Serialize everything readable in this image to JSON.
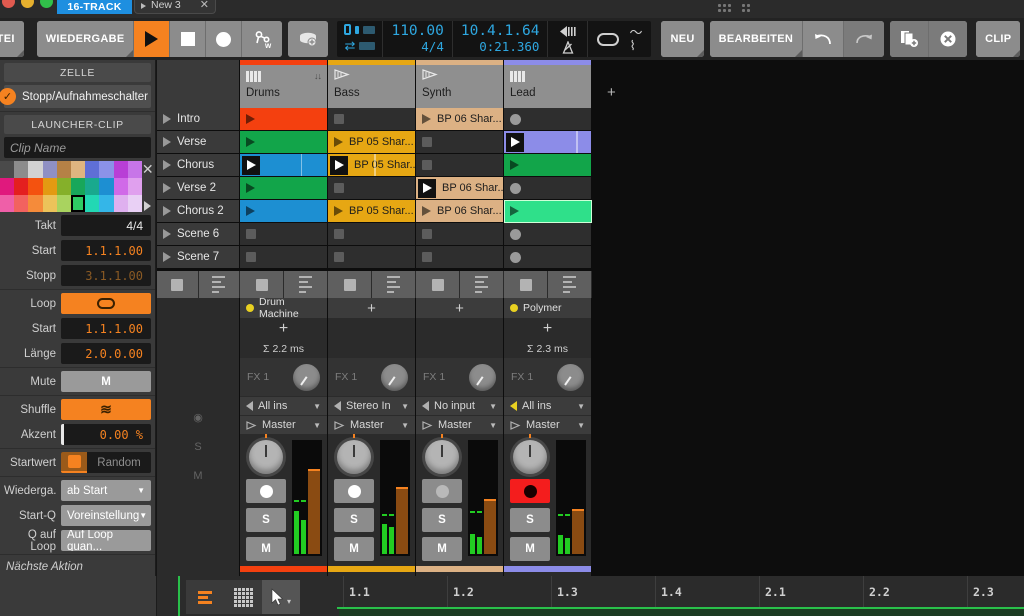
{
  "window": {
    "tab_16track": "16-TRACK",
    "tab_new": "New 3",
    "close_glyph": "✕"
  },
  "toolbar": {
    "file_label": "DATEI",
    "playback_label": "WIEDERGABE",
    "play_icon": "play-icon",
    "stop_icon": "stop-icon",
    "record_icon": "record-icon",
    "automation_icon": "automation-write-icon",
    "tap_icon": "tap-tempo-icon",
    "tempo": "110.00",
    "signature": "4/4",
    "position": "10.4.1.64",
    "time": "0:21.360",
    "preroll_icon": "pre-roll-icon",
    "metronome_icon": "metronome-icon",
    "loop_icon": "loop-icon",
    "curve_icons": [
      "fade-curve-icon",
      "groove-curve-icon"
    ],
    "new_label": "NEU",
    "edit_label": "BEARBEITEN",
    "undo_icon": "undo-icon",
    "redo_icon": "redo-icon",
    "duplicate_icon": "duplicate-icon",
    "delete_icon": "delete-icon",
    "clip_label": "CLIP"
  },
  "inspector": {
    "cell_header": "ZELLE",
    "stop_rec_toggle": "Stopp/Aufnahmeschalter",
    "stop_rec_checked": true,
    "launcher_header": "LAUNCHER-CLIP",
    "clip_name_placeholder": "Clip Name",
    "palette": {
      "close_glyph": "✕",
      "rows": [
        [
          "#4a4a4a",
          "#8c8c8c",
          "#d2d2d2",
          "#8f90c4",
          "#b58146",
          "#dfb580",
          "#5f6fd6",
          "#8b92e8",
          "#b83fd6",
          "#c775e8"
        ],
        [
          "#e0197d",
          "#e41f1f",
          "#f4520f",
          "#e39a12",
          "#85b02a",
          "#18a75a",
          "#19a98e",
          "#1d8fd2",
          "#d06ae8",
          "#e0a0ee"
        ],
        [
          "#ef5fa8",
          "#f2625f",
          "#f58b3a",
          "#ecc35a",
          "#a9d35f",
          "#2fcc63",
          "#22d8b4",
          "#34b6e8",
          "#dfb0ef",
          "#e9d0f5"
        ]
      ],
      "selected_row": 2,
      "selected_col": 5
    },
    "fields": [
      {
        "label": "Takt",
        "value": "4/4",
        "kind": "value-plain"
      },
      {
        "label": "Start",
        "value": "1.1.1.00",
        "kind": "value-orange"
      },
      {
        "label": "Stopp",
        "value": "3.1.1.00",
        "kind": "value-dim"
      },
      {
        "label": "Loop",
        "value": "loop-icon",
        "kind": "button-orange"
      },
      {
        "label": "Start",
        "value": "1.1.1.00",
        "kind": "value-orange"
      },
      {
        "label": "Länge",
        "value": "2.0.0.00",
        "kind": "value-orange"
      },
      {
        "label": "Mute",
        "value": "M",
        "kind": "button-grey"
      },
      {
        "label": "Shuffle",
        "value": "shuffle-icon",
        "kind": "button-orange"
      },
      {
        "label": "Akzent",
        "value": "0.00 %",
        "kind": "slider-orange"
      },
      {
        "label": "Startwert",
        "value": "Random",
        "kind": "seed"
      },
      {
        "label": "Wiederga.",
        "value": "ab Start",
        "kind": "select"
      },
      {
        "label": "Start-Q",
        "value": "Voreinstellung",
        "kind": "select"
      },
      {
        "label": "Q auf Loop",
        "value": "Auf Loop quan...",
        "kind": "select-plain"
      }
    ],
    "next_action_header": "Nächste Aktion"
  },
  "tracks": [
    {
      "name": "Drums",
      "color": "#f4400f",
      "icon": "keyboard-icon",
      "badge": "dropdown-icon",
      "device": "Drum Machine",
      "device_on": true,
      "latency": "Σ 2.2 ms",
      "fx_label": "FX 1",
      "input": "All ins",
      "input_active": false,
      "output": "Master",
      "armed": false,
      "solo": "S",
      "mute": "M",
      "meter_l": 38,
      "meter_r": 30,
      "peak": 46,
      "fader": 74
    },
    {
      "name": "Bass",
      "color": "#e6a713",
      "icon": "audio-wave-icon",
      "badge": null,
      "device": null,
      "device_on": false,
      "latency": null,
      "fx_label": "FX 1",
      "input": "Stereo In",
      "input_active": false,
      "output": "Master",
      "armed": false,
      "solo": "S",
      "mute": "M",
      "meter_l": 27,
      "meter_r": 24,
      "peak": 34,
      "fader": 58
    },
    {
      "name": "Synth",
      "color": "#dcb184",
      "icon": "audio-wave-icon",
      "badge": null,
      "device": null,
      "device_on": false,
      "latency": null,
      "fx_label": "FX 1",
      "input": "No input",
      "input_active": false,
      "output": "Master",
      "armed": false,
      "solo": "S",
      "mute": "M",
      "meter_l": 18,
      "meter_r": 15,
      "peak": 37,
      "fader": 47
    },
    {
      "name": "Lead",
      "color": "#8c8ce8",
      "icon": "keyboard-icon",
      "badge": null,
      "device": "Polymer",
      "device_on": true,
      "latency": "Σ 2.3 ms",
      "fx_label": "FX 1",
      "input": "All ins",
      "input_active": true,
      "output": "Master",
      "armed": true,
      "solo": "S",
      "mute": "M",
      "meter_l": 17,
      "meter_r": 14,
      "peak": 34,
      "fader": 38
    }
  ],
  "scenes": [
    {
      "name": "Intro"
    },
    {
      "name": "Verse"
    },
    {
      "name": "Chorus"
    },
    {
      "name": "Verse 2"
    },
    {
      "name": "Chorus 2"
    },
    {
      "name": "Scene 6"
    },
    {
      "name": "Scene 7"
    }
  ],
  "clips": [
    [
      {
        "state": "filled",
        "color": "#f4400f",
        "label": "",
        "mark": null
      },
      {
        "state": "empty",
        "stop": "square"
      },
      {
        "state": "filled",
        "color": "#dcb184",
        "label": "BP 06 Shar...",
        "mark": null
      },
      {
        "state": "empty",
        "stop": "circle"
      }
    ],
    [
      {
        "state": "filled",
        "color": "#12a54a",
        "label": "",
        "mark": null
      },
      {
        "state": "filled",
        "color": "#e6a713",
        "label": "BP 05 Shar...",
        "mark": null
      },
      {
        "state": "empty",
        "stop": "square"
      },
      {
        "state": "playing",
        "color": "#8c8ce8",
        "label": "",
        "mark": 83
      }
    ],
    [
      {
        "state": "playing",
        "color": "#1d8fd2",
        "label": "",
        "mark": 70
      },
      {
        "state": "playing",
        "color": "#e6a713",
        "label": "BP 05 Shar...",
        "mark": 53
      },
      {
        "state": "empty",
        "stop": "square"
      },
      {
        "state": "filled",
        "color": "#12a54a",
        "label": "",
        "mark": null
      }
    ],
    [
      {
        "state": "filled",
        "color": "#12a54a",
        "label": "",
        "mark": null
      },
      {
        "state": "empty",
        "stop": "square"
      },
      {
        "state": "playing",
        "color": "#dcb184",
        "label": "BP 06 Shar...",
        "mark": null
      },
      {
        "state": "empty",
        "stop": "circle"
      }
    ],
    [
      {
        "state": "filled",
        "color": "#1d8fd2",
        "label": "",
        "mark": null
      },
      {
        "state": "filled",
        "color": "#e6a713",
        "label": "BP 05 Shar...",
        "mark": null
      },
      {
        "state": "filled",
        "color": "#dcb184",
        "label": "BP 06 Shar...",
        "mark": null
      },
      {
        "state": "selected",
        "color": "#2fe08a",
        "label": "",
        "mark": null
      }
    ],
    [
      {
        "state": "empty",
        "stop": "square"
      },
      {
        "state": "empty",
        "stop": "square"
      },
      {
        "state": "empty",
        "stop": "square"
      },
      {
        "state": "empty",
        "stop": "circle"
      }
    ],
    [
      {
        "state": "empty",
        "stop": "square"
      },
      {
        "state": "empty",
        "stop": "square"
      },
      {
        "state": "empty",
        "stop": "square"
      },
      {
        "state": "empty",
        "stop": "circle"
      }
    ]
  ],
  "mixer_row_labels": [
    "record-overview-icon",
    "solo-overview-icon",
    "mute-overview-icon"
  ],
  "add_track_glyph": "+",
  "bottom": {
    "layers_icon": "layers-icon",
    "grid_icon": "grid-icon",
    "pointer_icon": "pointer-tool-icon",
    "ruler_labels": [
      "1.1",
      "1.2",
      "1.3",
      "1.4",
      "2.1",
      "2.2",
      "2.3"
    ]
  }
}
